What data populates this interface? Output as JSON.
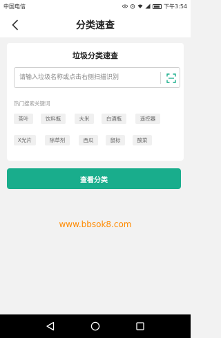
{
  "status_bar": {
    "carrier": "中国电信",
    "time": "下午3:54"
  },
  "navbar": {
    "title": "分类速查",
    "back_icon": "chevron-left-icon"
  },
  "card": {
    "title": "垃圾分类速查",
    "search": {
      "placeholder": "请输入垃圾名称或点击右侧扫描识别",
      "value": "",
      "scan_icon": "scan-icon"
    },
    "hot_label": "热门搜索关键词",
    "hot_keywords": [
      [
        "茶叶",
        "饮料瓶",
        "大米",
        "白酒瓶",
        "遥控器"
      ],
      [
        "X光片",
        "除草剂",
        "西瓜",
        "鼠标",
        "酸菜"
      ]
    ]
  },
  "primary_button": {
    "label": "查看分类"
  },
  "watermark": "www.bbsok8.com",
  "colors": {
    "accent": "#19ad8c",
    "watermark": "#ff8a00",
    "chip_bg": "#f0f0f0"
  },
  "system_nav": {
    "back_icon": "triangle-back-icon",
    "home_icon": "circle-home-icon",
    "recents_icon": "square-recents-icon"
  }
}
